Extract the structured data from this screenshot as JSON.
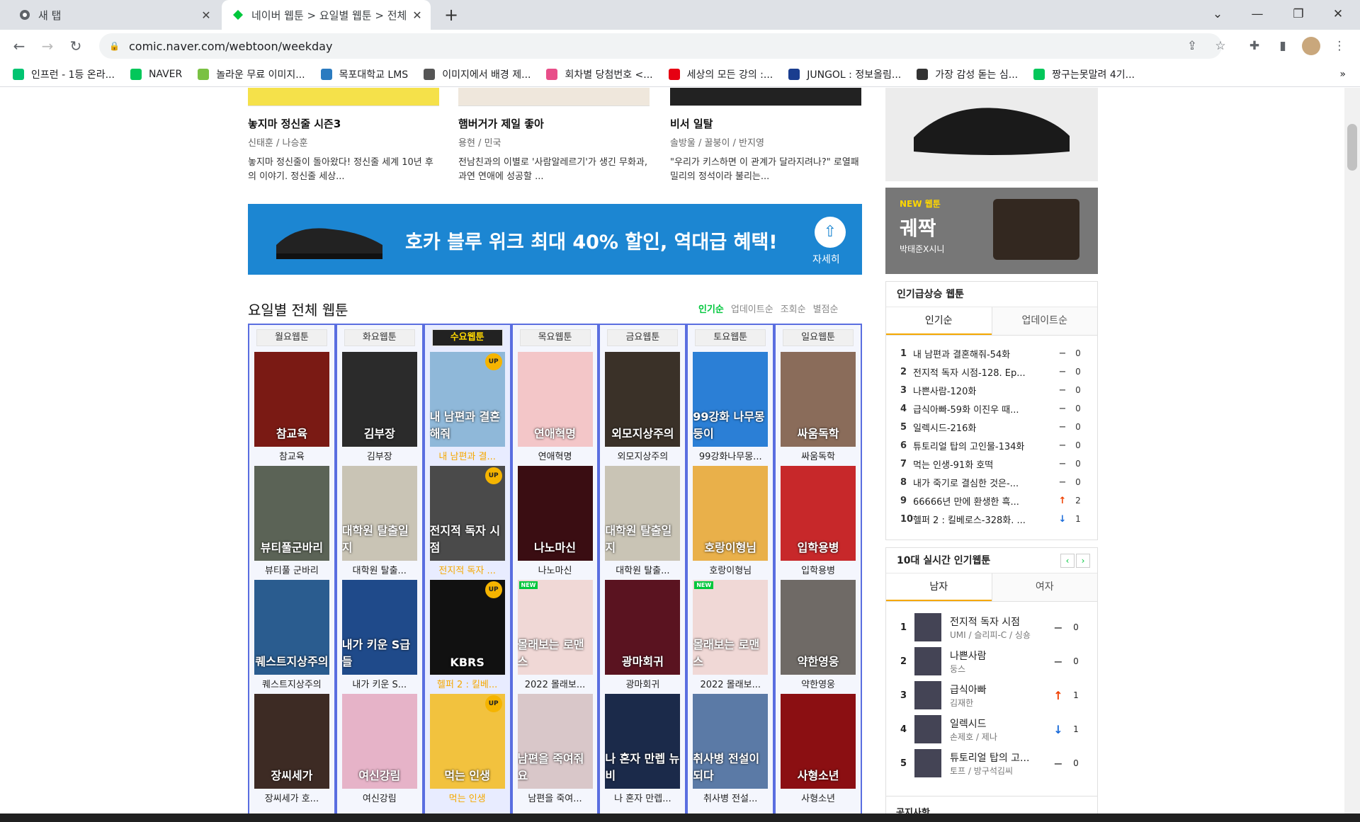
{
  "browser": {
    "tabs": [
      {
        "title": "새 탭",
        "active": false
      },
      {
        "title": "네이버 웹툰 > 요일별 웹툰 > 전체 웹툰",
        "active": true
      }
    ],
    "url": "comic.naver.com/webtoon/weekday",
    "bookmarks": [
      {
        "label": "인프런 - 1등 온라...",
        "color": "#00c471"
      },
      {
        "label": "NAVER",
        "color": "#03c75a"
      },
      {
        "label": "놀라운 무료 이미지...",
        "color": "#7ac143"
      },
      {
        "label": "목포대학교 LMS",
        "color": "#2b7bc0"
      },
      {
        "label": "이미지에서 배경 제...",
        "color": "#555555"
      },
      {
        "label": "회차별 당첨번호 <...",
        "color": "#e84e89"
      },
      {
        "label": "세상의 모든 강의 :...",
        "color": "#e60012"
      },
      {
        "label": "JUNGOL : 정보올림...",
        "color": "#1a3d8f"
      },
      {
        "label": "가장 감성 돋는 심...",
        "color": "#333333"
      },
      {
        "label": "짱구는못말려 4기...",
        "color": "#03c75a"
      }
    ]
  },
  "recommend": [
    {
      "title": "놓지마 정신줄 시즌3",
      "author": "신태훈 / 나승훈",
      "desc": "놓지마 정신줄이 돌아왔다! 정신줄 세계 10년 후의 이야기. 정신줄 세상..."
    },
    {
      "title": "햄버거가 제일 좋아",
      "author": "용현 / 민국",
      "desc": "전남친과의 이별로 '사람알레르기'가 생긴 무화과, 과연 연애에 성공할 ..."
    },
    {
      "title": "비서 일탈",
      "author": "솔방울 / 꿀붕이 / 반지영",
      "desc": "\"우리가 키스하면 이 관계가 달라지려나?\" 로열패밀리의 정석이라 불리는..."
    }
  ],
  "banner": {
    "text": "호카 블루 위크 최대 40% 할인, 역대급 혜택!",
    "button": "자세히"
  },
  "section": {
    "title": "요일별 전체 웹툰",
    "sorts": [
      "인기순",
      "업데이트순",
      "조회순",
      "별점순"
    ]
  },
  "days": [
    {
      "label": "월요웹툰",
      "items": [
        {
          "title": "참교육",
          "cover": "참교육",
          "bg": "#7a1a14"
        },
        {
          "title": "뷰티풀 군바리",
          "cover": "뷰티풀군바리",
          "bg": "#5b6356"
        },
        {
          "title": "퀘스트지상주의",
          "cover": "퀘스트지상주의",
          "bg": "#2a5c8f"
        },
        {
          "title": "장씨세가 호...",
          "cover": "장씨세가",
          "bg": "#3d2b24"
        }
      ]
    },
    {
      "label": "화요웹툰",
      "items": [
        {
          "title": "김부장",
          "cover": "김부장",
          "bg": "#2b2b2b"
        },
        {
          "title": "대학원 탈출...",
          "cover": "대학원 탈출일지",
          "bg": "#c9c4b5"
        },
        {
          "title": "내가 키운 S...",
          "cover": "내가 키운 S급들",
          "bg": "#1f4a8a"
        },
        {
          "title": "여신강림",
          "cover": "여신강림",
          "bg": "#e6b3c8"
        }
      ]
    },
    {
      "label": "수요웹툰",
      "items": [
        {
          "title": "내 남편과 결...",
          "cover": "내 남편과 결혼해줘",
          "bg": "#8fb8d9",
          "up": true
        },
        {
          "title": "전지적 독자 ...",
          "cover": "전지적 독자 시점",
          "bg": "#4a4a4a",
          "up": true
        },
        {
          "title": "헬퍼 2 : 킬베...",
          "cover": "KBRS",
          "bg": "#111111",
          "up": true
        },
        {
          "title": "먹는 인생",
          "cover": "먹는 인생",
          "bg": "#f2c23e",
          "up": true
        }
      ]
    },
    {
      "label": "목요웹툰",
      "items": [
        {
          "title": "연애혁명",
          "cover": "연애혁명",
          "bg": "#f3c6c8"
        },
        {
          "title": "나노마신",
          "cover": "나노마신",
          "bg": "#3a0d12"
        },
        {
          "title": "2022 몰래보...",
          "cover": "몰래보는 로맨스",
          "bg": "#f0d8d6",
          "new": true
        },
        {
          "title": "남편을 죽여...",
          "cover": "남편을 죽여줘요",
          "bg": "#d9c7c9"
        }
      ]
    },
    {
      "label": "금요웹툰",
      "items": [
        {
          "title": "외모지상주의",
          "cover": "외모지상주의",
          "bg": "#3a3128"
        },
        {
          "title": "대학원 탈출...",
          "cover": "대학원 탈출일지",
          "bg": "#c9c4b5"
        },
        {
          "title": "광마회귀",
          "cover": "광마회귀",
          "bg": "#5a1320"
        },
        {
          "title": "나 혼자 만렙...",
          "cover": "나 혼자 만렙 뉴비",
          "bg": "#1b2a4a"
        }
      ]
    },
    {
      "label": "토요웹툰",
      "items": [
        {
          "title": "99강화나무몽...",
          "cover": "99강화 나무몽둥이",
          "bg": "#2b7fd6"
        },
        {
          "title": "호랑이형님",
          "cover": "호랑이형님",
          "bg": "#e9b04a"
        },
        {
          "title": "2022 몰래보...",
          "cover": "몰래보는 로맨스",
          "bg": "#f0d8d6",
          "new": true
        },
        {
          "title": "취사병 전설...",
          "cover": "취사병 전설이 되다",
          "bg": "#5b7aa6"
        }
      ]
    },
    {
      "label": "일요웹툰",
      "items": [
        {
          "title": "싸움독학",
          "cover": "싸움독학",
          "bg": "#8a6c5a"
        },
        {
          "title": "입학용병",
          "cover": "입학용병",
          "bg": "#c7282a"
        },
        {
          "title": "약한영웅",
          "cover": "약한영웅",
          "bg": "#6f6a66"
        },
        {
          "title": "사형소년",
          "cover": "사형소년",
          "bg": "#8b0f12"
        }
      ]
    }
  ],
  "ads": {
    "new_label": "NEW 웹툰",
    "new_title": "궤짝",
    "new_sub": "박태준X시니"
  },
  "rising": {
    "title": "인기급상승 웹툰",
    "tabs": [
      "인기순",
      "업데이트순"
    ],
    "items": [
      {
        "rank": "1",
        "title": "내 남편과 결혼해줘-54화",
        "dir": "none",
        "count": "0"
      },
      {
        "rank": "2",
        "title": "전지적 독자 시점-128. Ep...",
        "dir": "none",
        "count": "0"
      },
      {
        "rank": "3",
        "title": "나쁜사람-120화",
        "dir": "none",
        "count": "0"
      },
      {
        "rank": "4",
        "title": "급식아빠-59화 이진우 때...",
        "dir": "none",
        "count": "0"
      },
      {
        "rank": "5",
        "title": "일렉시드-216화",
        "dir": "none",
        "count": "0"
      },
      {
        "rank": "6",
        "title": "튜토리얼 탑의 고인물-134화",
        "dir": "none",
        "count": "0"
      },
      {
        "rank": "7",
        "title": "먹는 인생-91화 호떡",
        "dir": "none",
        "count": "0"
      },
      {
        "rank": "8",
        "title": "내가 죽기로 결심한 것은-...",
        "dir": "none",
        "count": "0"
      },
      {
        "rank": "9",
        "title": "66666년 만에 환생한 흑...",
        "dir": "up",
        "count": "2"
      },
      {
        "rank": "10",
        "title": "헬퍼 2 : 킬베로스-328화. ...",
        "dir": "down",
        "count": "1"
      }
    ]
  },
  "realtime": {
    "title": "10대 실시간 인기웹툰",
    "tabs": [
      "남자",
      "여자"
    ],
    "items": [
      {
        "rank": "1",
        "title": "전지적 독자 시점",
        "author": "UMI / 슬리피-C / 싱숑",
        "dir": "none",
        "count": "0"
      },
      {
        "rank": "2",
        "title": "나쁜사람",
        "author": "둥스",
        "dir": "none",
        "count": "0"
      },
      {
        "rank": "3",
        "title": "급식아빠",
        "author": "김재한",
        "dir": "up",
        "count": "1"
      },
      {
        "rank": "4",
        "title": "일렉시드",
        "author": "손제호 / 제나",
        "dir": "down",
        "count": "1"
      },
      {
        "rank": "5",
        "title": "튜토리얼 탑의 고...",
        "author": "토프 / 방구석김씨",
        "dir": "none",
        "count": "0"
      }
    ]
  },
  "notice": "공지사항"
}
